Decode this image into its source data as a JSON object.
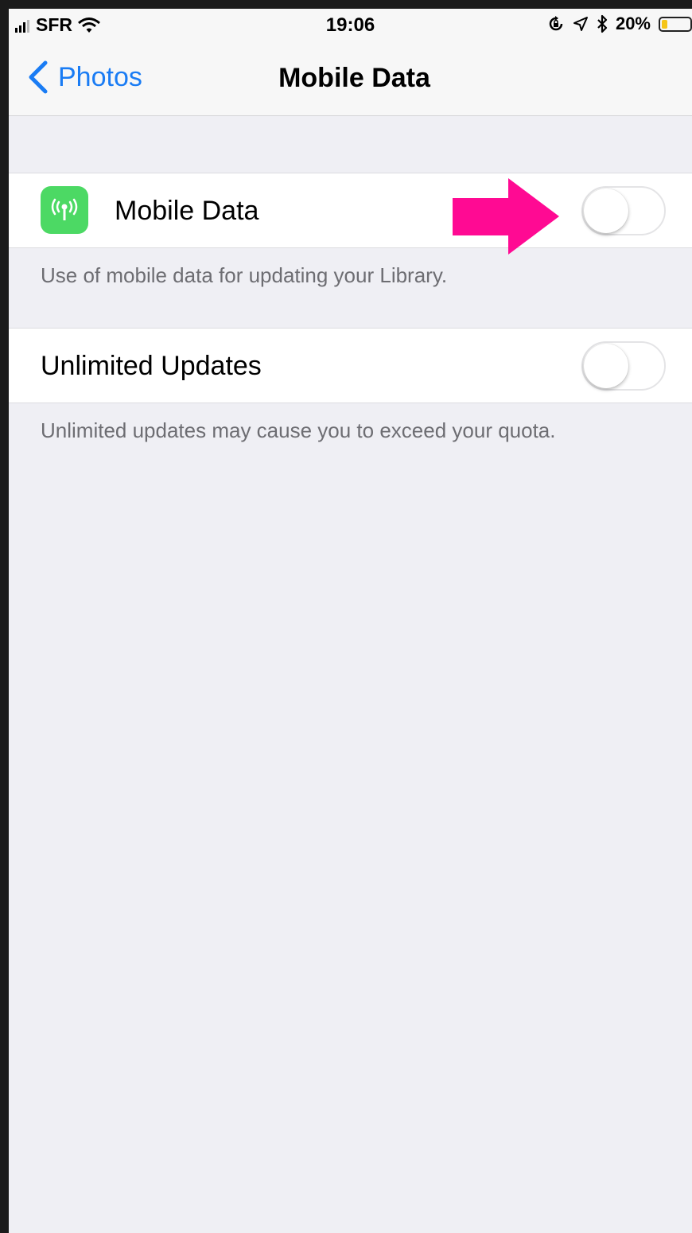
{
  "status_bar": {
    "carrier": "SFR",
    "time": "19:06",
    "battery_percent": "20%",
    "battery_level": 0.2,
    "icons": [
      "signal-icon",
      "wifi-icon",
      "orientation-lock-icon",
      "location-icon",
      "bluetooth-icon",
      "battery-icon"
    ],
    "battery_color": "#f5c518"
  },
  "nav": {
    "back_label": "Photos",
    "title": "Mobile Data"
  },
  "settings": {
    "mobile_data": {
      "label": "Mobile Data",
      "enabled": false,
      "icon": "antenna-icon",
      "icon_color": "#4cd964",
      "footer": "Use of mobile data for updating your Library."
    },
    "unlimited_updates": {
      "label": "Unlimited Updates",
      "enabled": false,
      "footer": "Unlimited updates may cause you to exceed your quota."
    }
  },
  "annotation": {
    "arrow_color": "#ff0a93"
  },
  "colors": {
    "accent": "#1a7cf4",
    "background": "#efeff4",
    "footer_text": "#6d6d72"
  }
}
